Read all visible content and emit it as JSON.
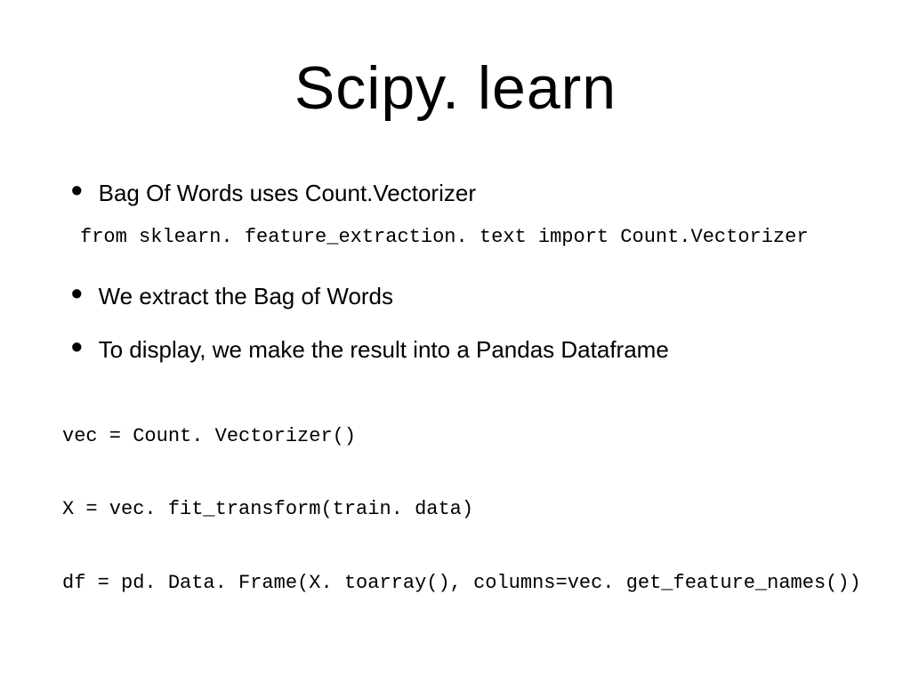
{
  "slide": {
    "title": "Scipy. learn",
    "bullets": [
      "Bag Of Words uses Count.Vectorizer",
      "We extract the Bag of Words",
      "To display, we make the result into a Pandas Dataframe"
    ],
    "code": {
      "import_line": "from sklearn. feature_extraction. text import Count.Vectorizer",
      "block_line1": "vec = Count. Vectorizer()",
      "block_line2": "X = vec. fit_transform(train. data)",
      "block_line3": "df = pd. Data. Frame(X. toarray(), columns=vec. get_feature_names())"
    }
  }
}
